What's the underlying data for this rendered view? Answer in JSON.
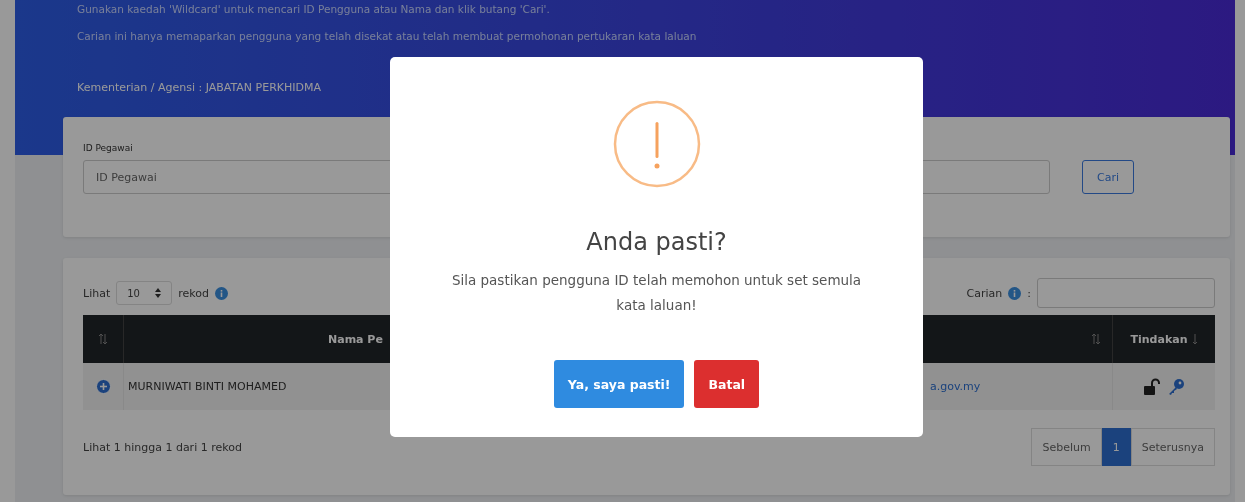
{
  "header": {
    "notes": [
      "Gunakan kaedah 'Wildcard' untuk mencari ID Pengguna atau Nama dan klik butang 'Cari'.",
      "Carian ini hanya memaparkan pengguna yang telah disekat atau telah membuat permohonan pertukaran kata laluan"
    ],
    "agency": "Kementerian / Agensi : JABATAN PERKHIDMA"
  },
  "search_form": {
    "label": "ID Pegawai",
    "field": {
      "placeholder": "ID Pegawai"
    },
    "button": "Cari"
  },
  "table": {
    "length_prefix": "Lihat",
    "length_value": "10",
    "length_suffix": "rekod",
    "search_label": "Carian",
    "search_colon": ":",
    "columns": [
      "Nama Pe",
      "Tindakan"
    ],
    "rows": [
      {
        "name": "MURNIWATI BINTI MOHAMED",
        "email": "a.gov.my"
      }
    ],
    "info": "Lihat 1 hingga 1 dari 1 rekod",
    "pagination": [
      {
        "label": "Sebelum",
        "selected": false
      },
      {
        "label": "1",
        "selected": true
      },
      {
        "label": "Seterusnya",
        "selected": false
      }
    ]
  },
  "dialog": {
    "title": "Anda pasti?",
    "message": "Sila pastikan pengguna ID telah memohon untuk set semula kata laluan!",
    "buttons": [
      {
        "label": "Ya, saya pasti!",
        "kind": "confirm"
      },
      {
        "label": "Batal",
        "kind": "cancel"
      }
    ]
  }
}
